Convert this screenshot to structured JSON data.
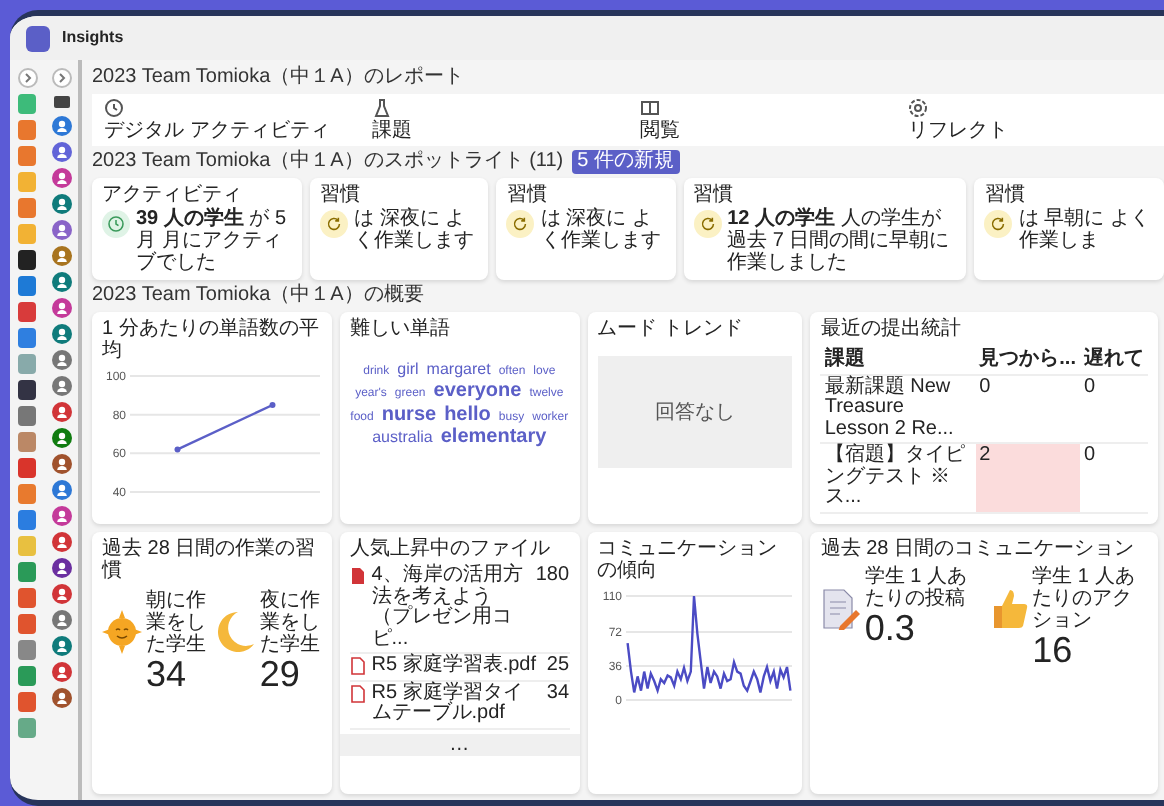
{
  "app": {
    "title": "Insights"
  },
  "report": {
    "heading": "2023 Team Tomioka（中１A）のレポート",
    "tabs": [
      {
        "kind": "activity",
        "label": "デジタル アクティビティ"
      },
      {
        "kind": "assignment",
        "label": "課題"
      },
      {
        "kind": "reading",
        "label": "閲覧"
      },
      {
        "kind": "reflect",
        "label": "リフレクト"
      }
    ]
  },
  "spotlight": {
    "heading": "2023 Team Tomioka（中１A）のスポットライト (11)",
    "badge": "5 件の新規",
    "cards": [
      {
        "kind": "activity",
        "title": "アクティビティ",
        "text": "**39 人の学生** が 5 月 月にアクティブでした"
      },
      {
        "kind": "habit",
        "title": "習慣",
        "text": "は 深夜に よく作業します"
      },
      {
        "kind": "habit",
        "title": "習慣",
        "text": "は 深夜に よく作業します"
      },
      {
        "kind": "habit",
        "title": "習慣",
        "text": "**12 人の学生** 人の学生が過去 7 日間の間に早朝に作業しました"
      },
      {
        "kind": "habit",
        "title": "習慣",
        "text": "は 早朝に よく作業しま"
      }
    ]
  },
  "overview": {
    "heading": "2023 Team Tomioka（中１A）の概要",
    "cards": [
      {
        "kind": "line_chart",
        "title": "1 分あたりの単語数の平均",
        "chart_data": {
          "type": "line",
          "grid": true,
          "ylim": [
            40,
            100
          ],
          "yticks": [
            40,
            60,
            80,
            100
          ],
          "series": [
            {
              "color": "#5b5fc7",
              "marker": true,
              "values": [
                62,
                85
              ]
            }
          ]
        }
      },
      {
        "kind": "word_cloud",
        "title": "難しい単語",
        "words": [
          {
            "text": "drink",
            "kind": "small"
          },
          {
            "text": "girl",
            "kind": "medium"
          },
          {
            "text": "margaret",
            "kind": "medium"
          },
          {
            "text": "often",
            "kind": "small"
          },
          {
            "text": "love",
            "kind": "small"
          },
          {
            "text": "year's",
            "kind": "small"
          },
          {
            "text": "green",
            "kind": "small"
          },
          {
            "text": "everyone",
            "kind": "large"
          },
          {
            "text": "twelve",
            "kind": "small"
          },
          {
            "text": "food",
            "kind": "small"
          },
          {
            "text": "nurse",
            "kind": "large"
          },
          {
            "text": "hello",
            "kind": "large"
          },
          {
            "text": "busy",
            "kind": "small"
          },
          {
            "text": "worker",
            "kind": "small"
          },
          {
            "text": "australia",
            "kind": "medium"
          },
          {
            "text": "elementary",
            "kind": "large"
          }
        ]
      },
      {
        "kind": "mood",
        "title": "ムード トレンド",
        "empty_text": "回答なし"
      },
      {
        "kind": "table",
        "title": "最近の提出統計",
        "columns": [
          "課題",
          "見つから...",
          "遅れて"
        ],
        "rows": [
          {
            "cells": [
              "最新課題 New Treasure Lesson 2 Re...",
              "0",
              "0"
            ],
            "alert": false
          },
          {
            "cells": [
              "【宿題】タイピングテスト ※ス...",
              "2",
              "0"
            ],
            "alert": true
          }
        ]
      },
      {
        "kind": "habits",
        "title": "過去 28 日間の作業の習慣",
        "stats": [
          {
            "kind": "sun",
            "label": "朝に作業をした学生",
            "value": "34"
          },
          {
            "kind": "moon",
            "label": "夜に作業をした学生",
            "value": "29"
          }
        ]
      },
      {
        "kind": "files",
        "title": "人気上昇中のファイル",
        "files": [
          {
            "kind": "slides",
            "name": "4、海岸の活用方法を考えよう（プレゼン用コピ...",
            "count": "180"
          },
          {
            "kind": "pdf",
            "name": "R5 家庭学習表.pdf",
            "count": "25"
          },
          {
            "kind": "pdf",
            "name": "R5 家庭学習タイムテーブル.pdf",
            "count": "34"
          }
        ],
        "more": "…"
      },
      {
        "kind": "trend",
        "title": "コミュニケーションの傾向",
        "chart_data": {
          "type": "line",
          "grid": true,
          "ylim": [
            0,
            110
          ],
          "yticks": [
            0,
            36,
            72,
            110
          ],
          "series": [
            {
              "color": "#4b4bc4",
              "values": [
                60,
                30,
                8,
                25,
                10,
                30,
                12,
                28,
                20,
                10,
                22,
                18,
                26,
                24,
                15,
                30,
                22,
                34,
                20,
                30,
                110,
                70,
                40,
                12,
                35,
                18,
                30,
                25,
                12,
                28,
                20,
                22,
                40,
                30,
                28,
                15,
                10,
                20,
                30,
                22,
                8,
                25,
                35,
                20,
                30,
                12,
                32,
                24,
                35,
                10
              ]
            }
          ]
        }
      },
      {
        "kind": "communication",
        "title": "過去 28 日間のコミュニケーション",
        "stats": [
          {
            "kind": "document",
            "label": "学生 1 人あたりの投稿",
            "value": "0.3"
          },
          {
            "kind": "thumb",
            "label": "学生 1 人あたりのアクション",
            "value": "16"
          }
        ]
      }
    ]
  }
}
